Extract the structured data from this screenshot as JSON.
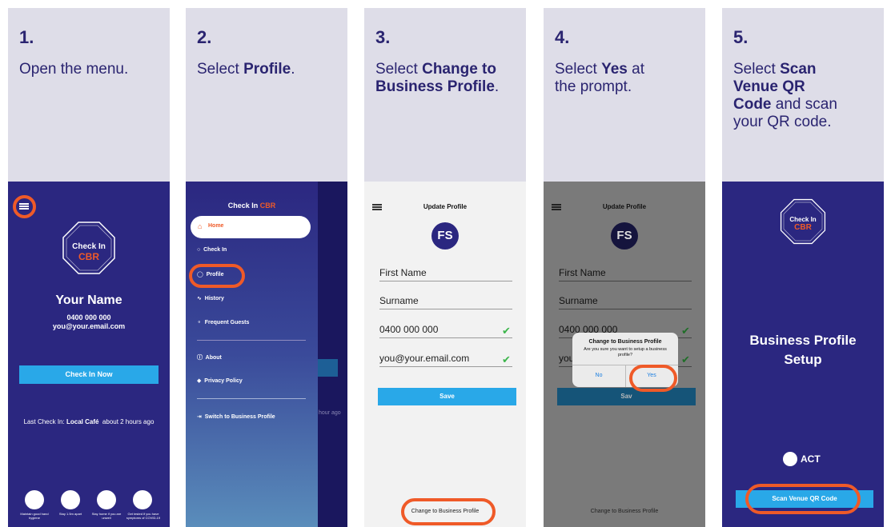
{
  "steps": [
    {
      "number": "1.",
      "text_before": "Open the menu.",
      "bold": "",
      "text_after": ""
    },
    {
      "number": "2.",
      "text_before": "Select ",
      "bold": "Profile",
      "text_after": "."
    },
    {
      "number": "3.",
      "text_before": "Select ",
      "bold": "Change to Business Profile",
      "text_after": "."
    },
    {
      "number": "4.",
      "text_before": "Select ",
      "bold": "Yes",
      "text_after": " at the prompt."
    },
    {
      "number": "5.",
      "text_before": "Select ",
      "bold": "Scan Venue QR Code",
      "text_after": " and scan your QR code."
    }
  ],
  "colors": {
    "navy": "#2b2780",
    "accent": "#ef5a28",
    "button_blue": "#29a8e8",
    "panel_bg": "#dedde8",
    "check": "#3bb54a"
  },
  "screen1": {
    "logo_line1": "Check In",
    "logo_line2": "CBR",
    "user_name": "Your Name",
    "phone": "0400 000 000",
    "email": "you@your.email.com",
    "check_in_button": "Check In Now",
    "last_check_in_label": "Last Check In:",
    "last_check_in_venue": "Local Café",
    "last_check_in_time": "about 2 hours ago",
    "tips": [
      {
        "icon": "hand-hygiene-icon",
        "label": "Maintain good hand hygiene"
      },
      {
        "icon": "distance-icon",
        "label": "Stay 1.5m apart"
      },
      {
        "icon": "stay-home-icon",
        "label": "Stay home if you are unwell"
      },
      {
        "icon": "test-swab-icon",
        "label": "Get tested if you have symptoms of COVID-19"
      }
    ]
  },
  "screen2": {
    "menu_title": "Check In",
    "menu_title_accent": "CBR",
    "items": [
      {
        "icon": "home-icon",
        "label": "Home"
      },
      {
        "icon": "check-in-icon",
        "label": "Check In"
      },
      {
        "icon": "profile-icon",
        "label": "Profile"
      },
      {
        "icon": "history-icon",
        "label": "History"
      },
      {
        "icon": "guests-icon",
        "label": "Frequent Guests"
      },
      {
        "icon": "info-icon",
        "label": "About"
      },
      {
        "icon": "shield-icon",
        "label": "Privacy Policy"
      },
      {
        "icon": "switch-icon",
        "label": "Switch to Business Profile"
      }
    ],
    "behind_text": "hour ago"
  },
  "screen3": {
    "title": "Update Profile",
    "initials": "FS",
    "first_name": "First Name",
    "surname": "Surname",
    "phone": "0400 000 000",
    "email": "you@your.email.com",
    "save_button": "Save",
    "change_link": "Change to Business Profile"
  },
  "screen4": {
    "title": "Update Profile",
    "initials": "FS",
    "first_name": "First Name",
    "surname": "Surname",
    "phone": "0400 000 000",
    "email_partial": "you",
    "save_partial": "Sav",
    "dialog_title": "Change to Business Profile",
    "dialog_message": "Are you sure you want to setup a business profile?",
    "dialog_no": "No",
    "dialog_yes": "Yes",
    "change_link": "Change to Business Profile"
  },
  "screen5": {
    "logo_line1": "Check In",
    "logo_line2": "CBR",
    "heading_line1": "Business Profile",
    "heading_line2": "Setup",
    "gov_logo": "ACT",
    "scan_button": "Scan Venue QR Code"
  }
}
